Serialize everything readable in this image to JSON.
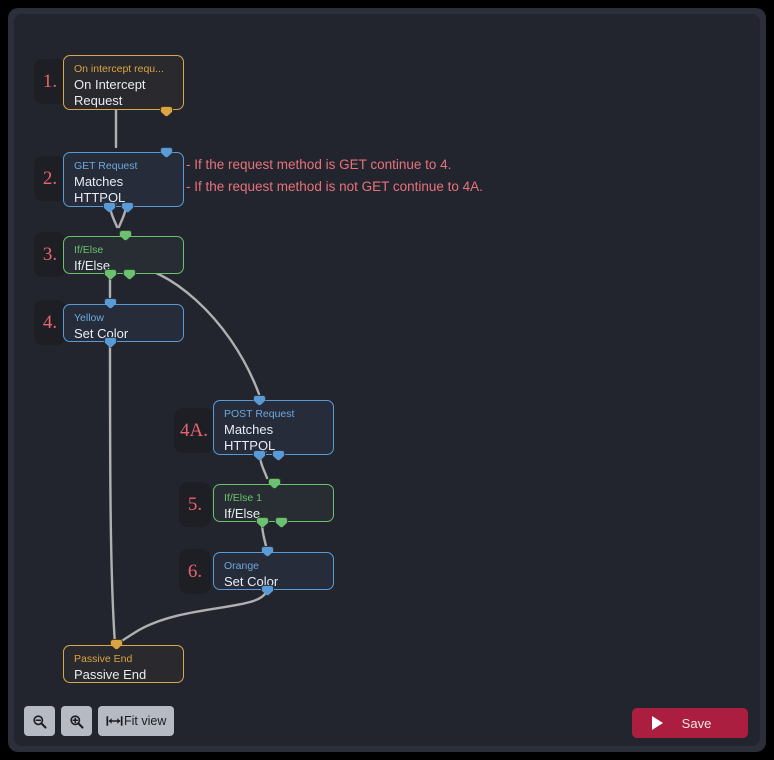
{
  "editor": {
    "annotation_lines": [
      "- If the request method is GET continue to 4.",
      "- If the request method is not GET continue to 4A."
    ]
  },
  "nodes": [
    {
      "badge": "1.",
      "type": "On intercept requ...",
      "title": "On Intercept Request"
    },
    {
      "badge": "2.",
      "type": "GET Request",
      "title": "Matches HTTPQL"
    },
    {
      "badge": "3.",
      "type": "If/Else",
      "title": "If/Else"
    },
    {
      "badge": "4.",
      "type": "Yellow",
      "title": "Set Color"
    },
    {
      "badge": "4A.",
      "type": "POST Request",
      "title": "Matches HTTPQL"
    },
    {
      "badge": "5.",
      "type": "If/Else 1",
      "title": "If/Else"
    },
    {
      "badge": "6.",
      "type": "Orange",
      "title": "Set Color"
    },
    {
      "badge": "",
      "type": "Passive End",
      "title": "Passive End"
    }
  ],
  "controls": {
    "zoom_out_label": "zoom-out",
    "zoom_in_label": "zoom-in",
    "fit_view_label": "Fit view"
  },
  "footer": {
    "save_label": "Save"
  },
  "colors": {
    "canvas_bg": "#22252d",
    "node_blue": "#5b9bd5",
    "node_green": "#6cc070",
    "node_gold": "#d9a441",
    "badge_text": "#e8646e",
    "annotation": "#e8727c",
    "save_bg": "#ab1e3f",
    "edge": "#b0b0b0"
  }
}
